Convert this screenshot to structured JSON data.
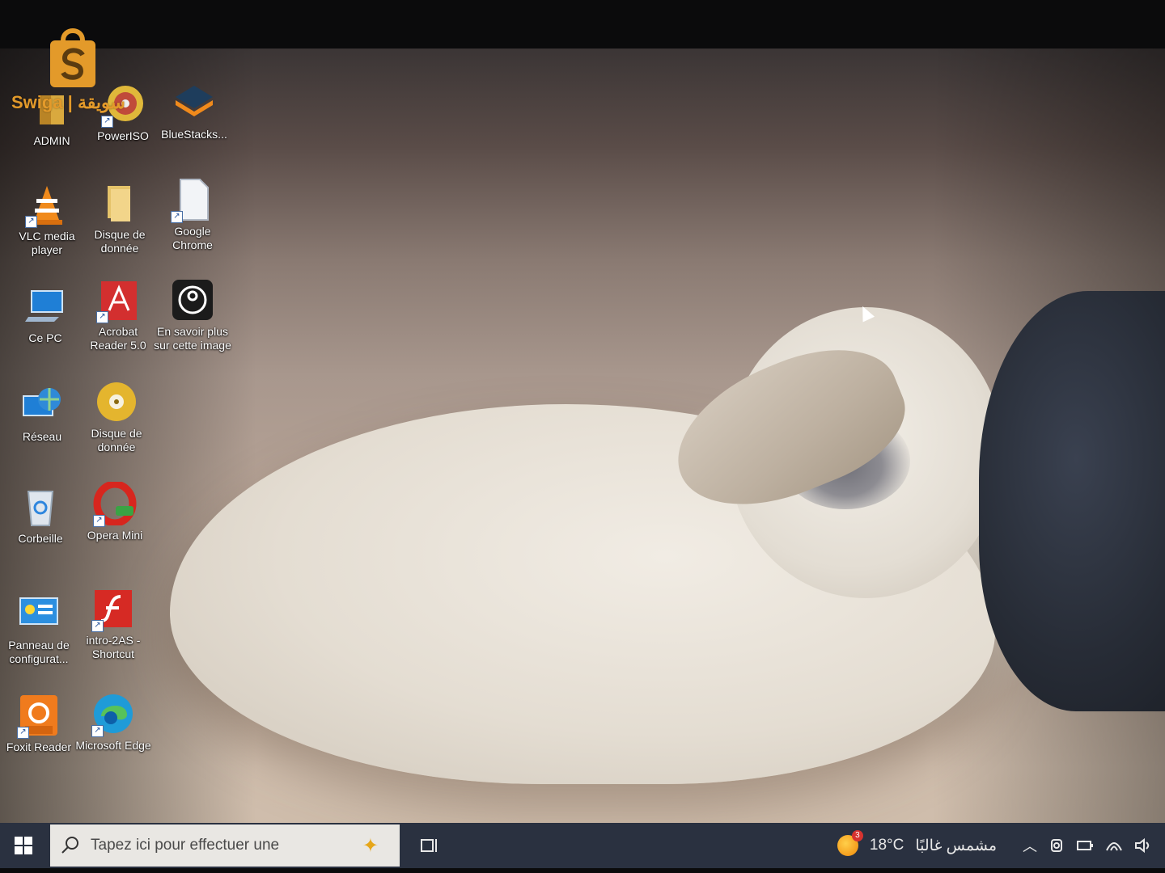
{
  "watermark": {
    "text": "Swiga | سويقة"
  },
  "desktop": {
    "icons": [
      {
        "label": "ADMIN",
        "icon": "user-folder-icon"
      },
      {
        "label": "PowerISO",
        "icon": "poweriso-icon"
      },
      {
        "label": "BlueStacks...",
        "icon": "bluestacks-icon"
      },
      {
        "label": "VLC media player",
        "icon": "vlc-icon"
      },
      {
        "label": "Disque de donnée",
        "icon": "folder-icon"
      },
      {
        "label": "Google Chrome",
        "icon": "file-icon"
      },
      {
        "label": "Ce PC",
        "icon": "computer-icon"
      },
      {
        "label": "Acrobat Reader 5.0",
        "icon": "acrobat-icon"
      },
      {
        "label": "En savoir plus sur cette image",
        "icon": "camera-info-icon"
      },
      {
        "label": "Réseau",
        "icon": "network-icon"
      },
      {
        "label": "Disque de donnée",
        "icon": "disc-icon"
      },
      {
        "label": "Corbeille",
        "icon": "recycle-bin-icon"
      },
      {
        "label": "Opera Mini",
        "icon": "opera-mini-icon"
      },
      {
        "label": "Panneau de configurat...",
        "icon": "control-panel-icon"
      },
      {
        "label": "intro-2AS - Shortcut",
        "icon": "flash-icon"
      },
      {
        "label": "Foxit Reader",
        "icon": "foxit-pdf-icon"
      },
      {
        "label": "Microsoft Edge",
        "icon": "edge-icon"
      }
    ]
  },
  "taskbar": {
    "search_placeholder": "Tapez ici pour effectuer une",
    "weather_temp": "18°C",
    "weather_text": "مشمس غالبًا",
    "weather_badge": "3"
  }
}
